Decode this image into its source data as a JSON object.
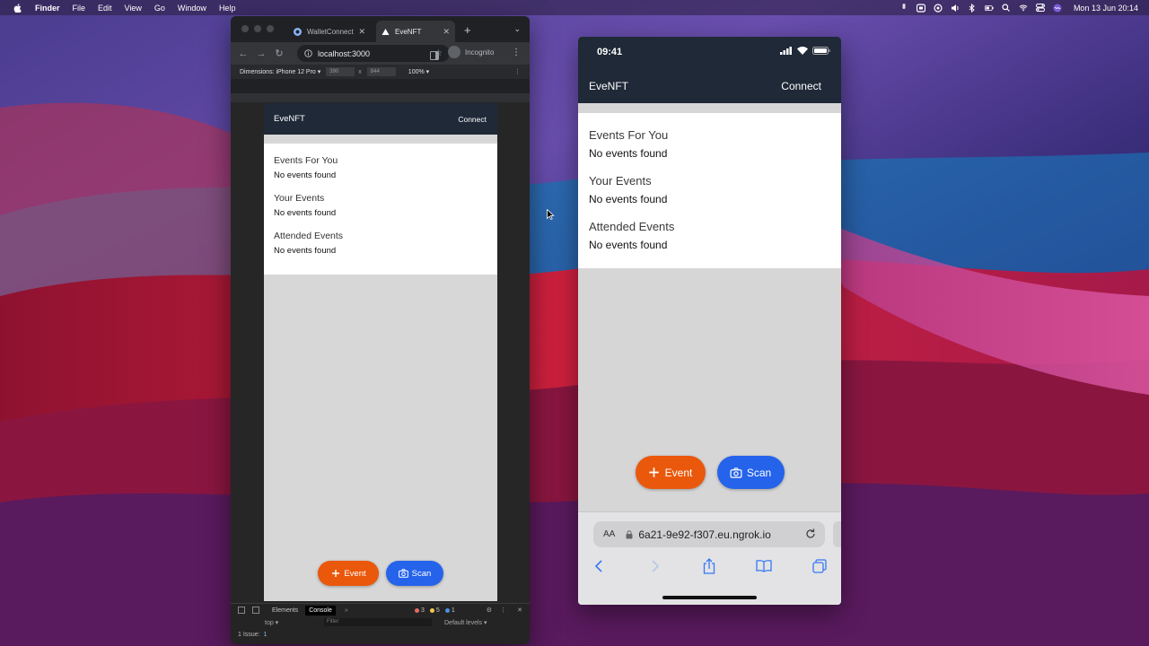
{
  "menubar": {
    "app": "Finder",
    "items": [
      "File",
      "Edit",
      "View",
      "Go",
      "Window",
      "Help"
    ],
    "clock": "Mon 13 Jun  20:14"
  },
  "chrome": {
    "tabs": [
      {
        "title": "WalletConnect",
        "active": false
      },
      {
        "title": "EveNFT",
        "active": true
      }
    ],
    "url": "localhost:3000",
    "profile": "Incognito",
    "device_toolbar": {
      "dimensions_label": "Dimensions: iPhone 12 Pro ▾",
      "width": "390",
      "height": "844",
      "zoom": "100% ▾"
    },
    "devtools": {
      "tabs": [
        "Elements",
        "Console"
      ],
      "active_tab": "Console",
      "errors": "3",
      "warnings": "5",
      "info": "1",
      "context": "top ▾",
      "filter_placeholder": "Filter",
      "levels": "Default levels ▾",
      "issues": "1 Issue:",
      "issues_count": "1"
    }
  },
  "app": {
    "brand": "EveNFT",
    "connect_label": "Connect",
    "sections": [
      {
        "title": "Events For You",
        "empty": "No events found"
      },
      {
        "title": "Your Events",
        "empty": "No events found"
      },
      {
        "title": "Attended Events",
        "empty": "No events found"
      }
    ],
    "event_button": "Event",
    "scan_button": "Scan",
    "colors": {
      "header": "#1f2937",
      "event": "#ea580c",
      "scan": "#2563eb"
    }
  },
  "phone": {
    "time": "09:41",
    "safari_aa": "AA",
    "url": "6a21-9e92-f307.eu.ngrok.io"
  }
}
